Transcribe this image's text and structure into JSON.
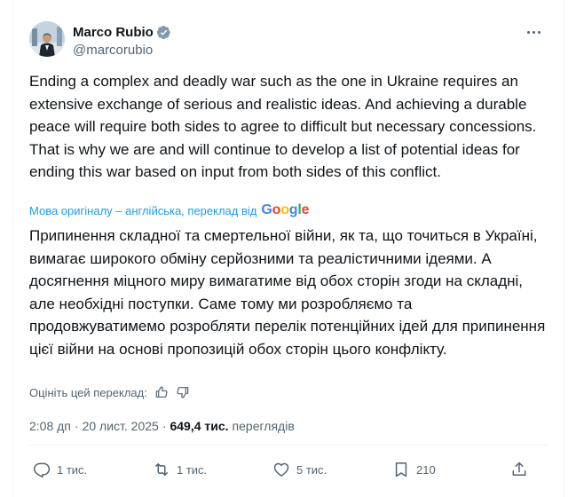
{
  "tweet": {
    "author": {
      "display_name": "Marco Rubio",
      "handle": "@marcorubio",
      "verified": true
    },
    "text": "Ending a complex and deadly war such as the one in Ukraine requires an extensive exchange of serious and realistic ideas. And achieving a durable peace will require both sides to agree to difficult but necessary concessions. That is why we are and will continue to develop a list of potential ideas for ending this war based on input from both sides of this conflict.",
    "translation": {
      "label": "Мова оригіналу – англійська, переклад від",
      "provider": "Google",
      "text": "Припинення складної та смертельної війни, як та, що точиться в Україні, вимагає широкого обміну серйозними та реалістичними ідеями. А досягнення міцного миру вимагатиме від обох сторін згоди на складні, але необхідні поступки. Саме тому ми розробляємо та продовжуватимемо розробляти перелік потенційних ідей для припинення цієї війни на основі пропозицій обох сторін цього конфлікту.",
      "rate_label": "Оцініть цей переклад:"
    },
    "time": "2:08 дп",
    "separator": "·",
    "date": "20 лист. 2025",
    "views_count": "649,4 тис.",
    "views_label": "переглядів",
    "actions": {
      "replies": "1 тис.",
      "reposts": "1 тис.",
      "likes": "5 тис.",
      "bookmarks": "210"
    }
  },
  "colors": {
    "text": "#0f1419",
    "secondary": "#536471",
    "link": "#1d9bf0",
    "verified": "#829aab",
    "border": "#eff3f4"
  }
}
